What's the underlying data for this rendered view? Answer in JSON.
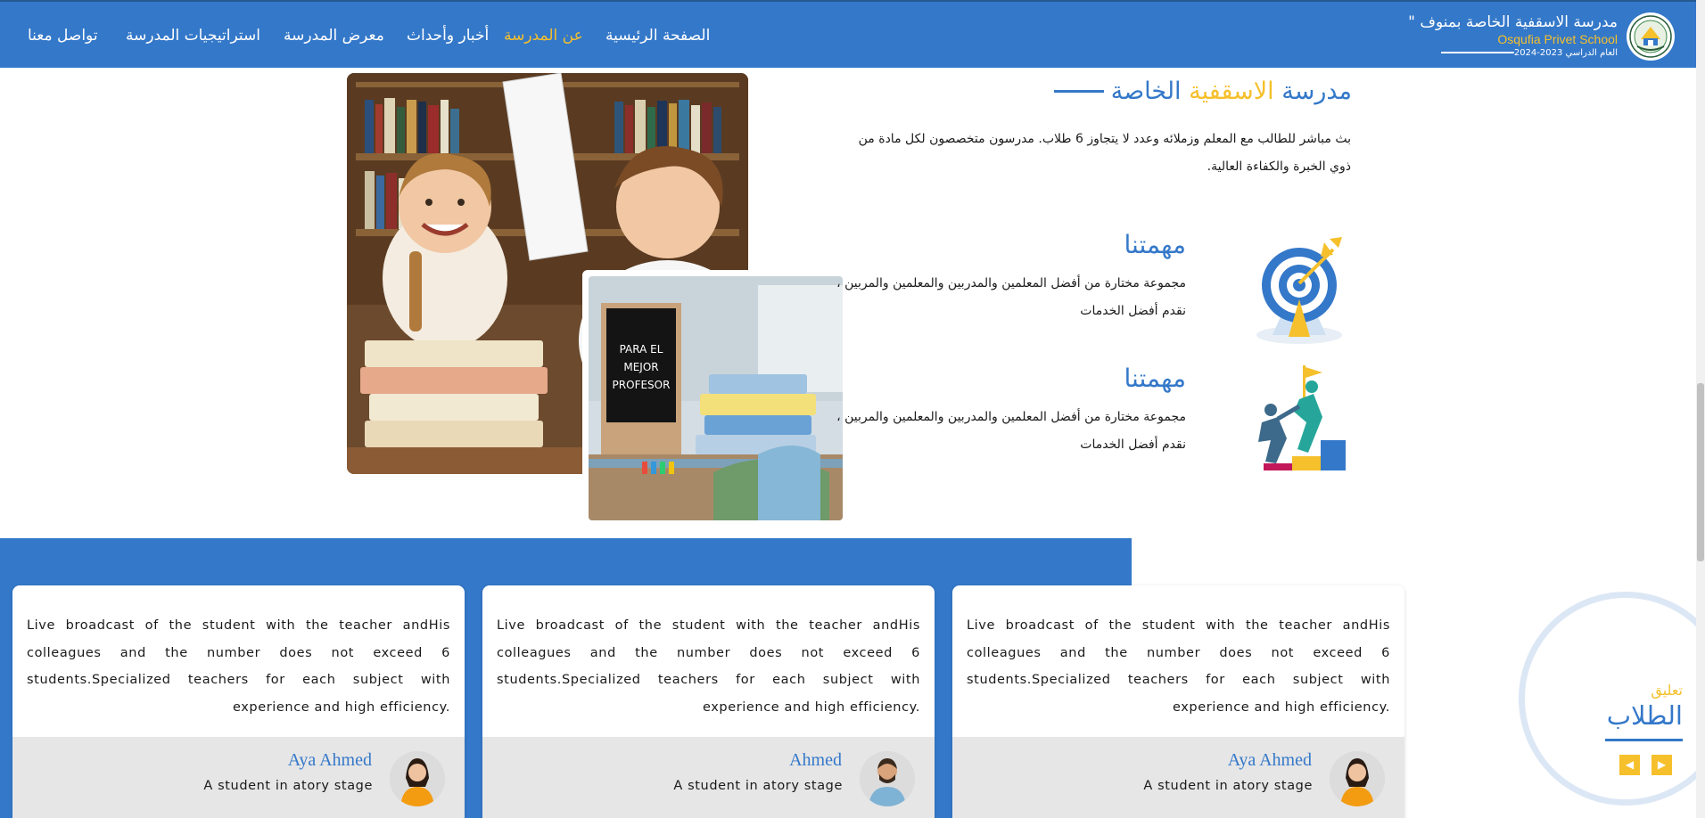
{
  "brand": {
    "title": "مدرسة الاسقفية الخاصة بمنوف \"",
    "subtitle": "Osqufia Privet School",
    "year": "العام الدراسي 2023-2024"
  },
  "nav": {
    "items": [
      {
        "label": "الصفحة الرئيسية",
        "active": false
      },
      {
        "label": "عن المدرسة",
        "active": true
      },
      {
        "label": "أخبار وأحداث",
        "active": false
      },
      {
        "label": "معرض المدرسة",
        "active": false
      },
      {
        "label": "استراتيجيات المدرسة",
        "active": false
      },
      {
        "label": "تواصل معنا",
        "active": false
      }
    ]
  },
  "photos": {
    "main_sign_text": [
      "PARA EL",
      "MEJOR",
      "PROFESOR"
    ]
  },
  "about": {
    "title_prefix": "مدرسة",
    "title_highlight": "الاسقفية",
    "title_suffix": "الخاصة",
    "description": "بث مباشر للطالب مع المعلم وزملائه وعدد لا يتجاوز 6 طلاب. مدرسون متخصصون لكل مادة من ذوي الخبرة والكفاءة العالية."
  },
  "features": [
    {
      "icon": "target-arrow-icon",
      "title": "مهمتنا",
      "description": "مجموعة مختارة من أفضل المعلمين والمدربين والمعلمين والمربين ، نقدم أفضل الخدمات"
    },
    {
      "icon": "climb-teamwork-icon",
      "title": "مهمتنا",
      "description": "مجموعة مختارة من أفضل المعلمين والمدربين والمعلمين والمربين ، نقدم أفضل الخدمات"
    }
  ],
  "testimonials": {
    "section_sub": "تعليق",
    "section_title": "الطلاب",
    "cards": [
      {
        "text": "Live broadcast of the student with the teacher andHis colleagues and the number does not exceed 6 students.Specialized teachers for each subject with experience and high efficiency.",
        "name": "Aya Ahmed",
        "role": "A student in atory stage",
        "avatar": "female-student-avatar"
      },
      {
        "text": "Live broadcast of the student with the teacher andHis colleagues and the number does not exceed 6 students.Specialized teachers for each subject with experience and high efficiency.",
        "name": "Ahmed",
        "role": "A student in atory stage",
        "avatar": "male-student-avatar"
      },
      {
        "text": "Live broadcast of the student with the teacher andHis colleagues and the number does not exceed 6 students.Specialized teachers for each subject with experience and high efficiency.",
        "name": "Aya Ahmed",
        "role": "A student in atory stage",
        "avatar": "female-student-avatar"
      }
    ],
    "prev_icon": "chevron-left-icon",
    "next_icon": "chevron-right-icon"
  },
  "colors": {
    "primary": "#3478c9",
    "accent": "#f5c02b",
    "card_footer": "#e6e6e6"
  }
}
